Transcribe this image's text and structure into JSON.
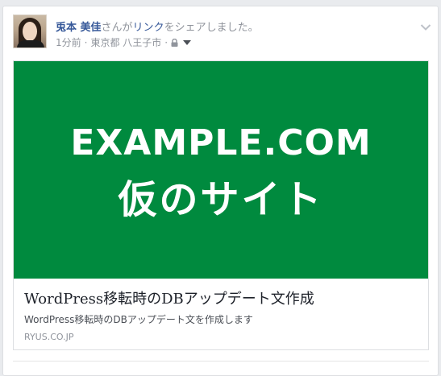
{
  "post": {
    "author_name": "兎本 美佳",
    "action_prefix": "さんが",
    "action_link": "リンク",
    "action_suffix": "をシェアしました。",
    "time": "1分前",
    "separator1": "·",
    "location": "東京都 八王子市",
    "separator2": "·",
    "privacy_icon": "lock-icon",
    "audience_icon": "caret-down-icon",
    "options_icon": "chevron-down-icon"
  },
  "link_preview": {
    "image_line1": "EXAMPLE.COM",
    "image_line2": "仮のサイト",
    "title": "WordPress移転時のDBアップデート文作成",
    "description": "WordPress移転時のDBアップデート文を作成します",
    "domain": "RYUS.CO.JP"
  },
  "colors": {
    "hero_background": "#008a3e",
    "author_link": "#365899",
    "meta_text": "#90949c"
  }
}
